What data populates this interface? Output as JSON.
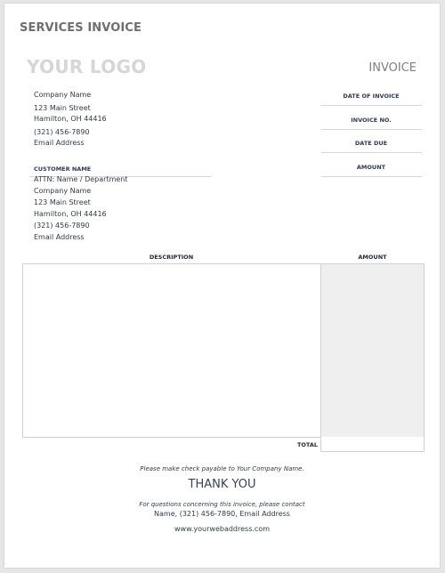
{
  "document": {
    "title": "SERVICES INVOICE",
    "logo_placeholder": "YOUR LOGO",
    "invoice_label": "INVOICE"
  },
  "sender": {
    "company_name": "Company Name",
    "street": "123 Main Street",
    "city_state_zip": "Hamilton, OH  44416",
    "phone": "(321) 456-7890",
    "email": "Email Address"
  },
  "invoice_meta": {
    "fields": [
      {
        "label": "DATE OF INVOICE",
        "value": ""
      },
      {
        "label": "INVOICE NO.",
        "value": ""
      },
      {
        "label": "DATE DUE",
        "value": ""
      },
      {
        "label": "AMOUNT",
        "value": ""
      }
    ]
  },
  "customer": {
    "heading": "CUSTOMER NAME",
    "attn": "ATTN: Name / Department",
    "company_name": "Company Name",
    "street": "123 Main Street",
    "city_state_zip": "Hamilton, OH  44416",
    "phone": "(321) 456-7890",
    "email": "Email Address"
  },
  "line_items": {
    "columns": [
      "DESCRIPTION",
      "AMOUNT"
    ],
    "rows": [],
    "total_label": "TOTAL",
    "total_value": ""
  },
  "colors": {
    "heading_navy": "#2e3a4f",
    "amount_column_fill": "#efefef",
    "logo_placeholder": "#d6d6d6"
  },
  "footer": {
    "payable_note": "Please make check payable to Your Company Name.",
    "thank_you": "THANK YOU",
    "questions_note": "For questions concerning this invoice, please contact",
    "contact_line": "Name, (321) 456-7890, Email Address",
    "website": "www.yourwebaddress.com"
  }
}
